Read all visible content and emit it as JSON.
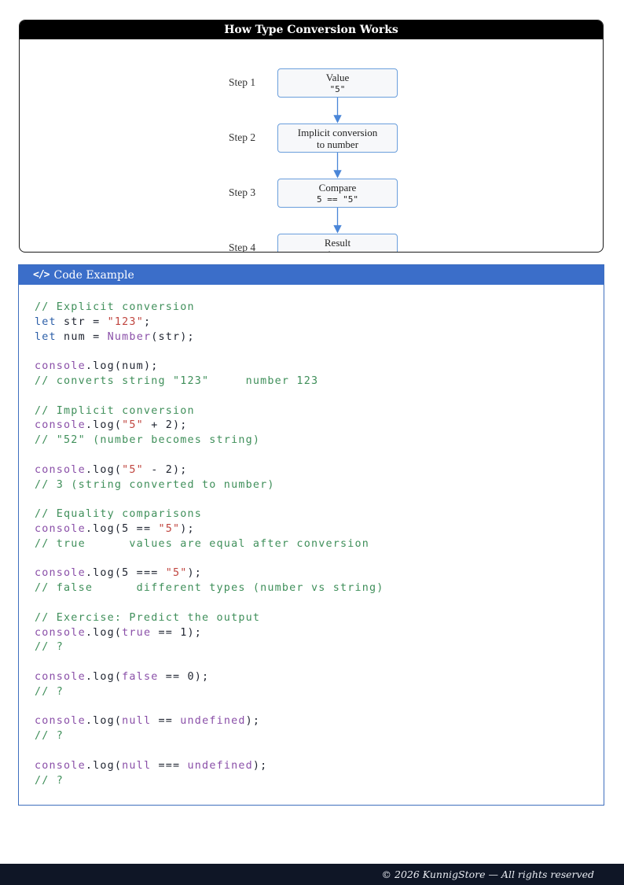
{
  "diagram": {
    "title": "How Type Conversion Works",
    "steps": [
      {
        "label": "Step 1",
        "title": "Value",
        "value": "\"5\""
      },
      {
        "label": "Step 2",
        "title": "Implicit conversion",
        "value": "to number"
      },
      {
        "label": "Step 3",
        "title": "Compare",
        "value": "5 == \"5\""
      },
      {
        "label": "Step 4",
        "title": "Result",
        "value": "true"
      }
    ]
  },
  "code_panel": {
    "icon": "code-icon",
    "title": "Code Example",
    "lines": [
      [
        [
          "c",
          "// Explicit conversion"
        ]
      ],
      [
        [
          "kw",
          "let"
        ],
        [
          "tx",
          " str = "
        ],
        [
          "st",
          "\"123\""
        ],
        [
          "tx",
          ";"
        ]
      ],
      [
        [
          "kw",
          "let"
        ],
        [
          "tx",
          " num = "
        ],
        [
          "fn",
          "Number"
        ],
        [
          "tx",
          "(str);"
        ]
      ],
      [],
      [
        [
          "cn",
          "console"
        ],
        [
          "tx",
          ".log(num);"
        ]
      ],
      [
        [
          "c",
          "// converts string \"123\"     number 123"
        ]
      ],
      [],
      [
        [
          "c",
          "// Implicit conversion"
        ]
      ],
      [
        [
          "cn",
          "console"
        ],
        [
          "tx",
          ".log("
        ],
        [
          "st",
          "\"5\""
        ],
        [
          "tx",
          " + 2);"
        ]
      ],
      [
        [
          "c",
          "// \"52\" (number becomes string)"
        ]
      ],
      [],
      [
        [
          "cn",
          "console"
        ],
        [
          "tx",
          ".log("
        ],
        [
          "st",
          "\"5\""
        ],
        [
          "tx",
          " - 2);"
        ]
      ],
      [
        [
          "c",
          "// 3 (string converted to number)"
        ]
      ],
      [],
      [
        [
          "c",
          "// Equality comparisons"
        ]
      ],
      [
        [
          "cn",
          "console"
        ],
        [
          "tx",
          ".log(5 == "
        ],
        [
          "st",
          "\"5\""
        ],
        [
          "tx",
          ");"
        ]
      ],
      [
        [
          "c",
          "// true      values are equal after conversion"
        ]
      ],
      [],
      [
        [
          "cn",
          "console"
        ],
        [
          "tx",
          ".log(5 === "
        ],
        [
          "st",
          "\"5\""
        ],
        [
          "tx",
          ");"
        ]
      ],
      [
        [
          "c",
          "// false      different types (number vs string)"
        ]
      ],
      [],
      [
        [
          "c",
          "// Exercise: Predict the output"
        ]
      ],
      [
        [
          "cn",
          "console"
        ],
        [
          "tx",
          ".log("
        ],
        [
          "bl",
          "true"
        ],
        [
          "tx",
          " == 1);"
        ]
      ],
      [
        [
          "c",
          "// ?"
        ]
      ],
      [],
      [
        [
          "cn",
          "console"
        ],
        [
          "tx",
          ".log("
        ],
        [
          "bl",
          "false"
        ],
        [
          "tx",
          " == 0);"
        ]
      ],
      [
        [
          "c",
          "// ?"
        ]
      ],
      [],
      [
        [
          "cn",
          "console"
        ],
        [
          "tx",
          ".log("
        ],
        [
          "bl",
          "null"
        ],
        [
          "tx",
          " == "
        ],
        [
          "bl",
          "undefined"
        ],
        [
          "tx",
          ");"
        ]
      ],
      [
        [
          "c",
          "// ?"
        ]
      ],
      [],
      [
        [
          "cn",
          "console"
        ],
        [
          "tx",
          ".log("
        ],
        [
          "bl",
          "null"
        ],
        [
          "tx",
          " === "
        ],
        [
          "bl",
          "undefined"
        ],
        [
          "tx",
          ");"
        ]
      ],
      [
        [
          "c",
          "// ?"
        ]
      ]
    ]
  },
  "footer": {
    "text": "© 2026 KunnigStore — All rights reserved"
  },
  "colors": {
    "code_header": "#3b6ec9",
    "box_border": "#6a9edc",
    "footer_bg": "#0f1626"
  }
}
